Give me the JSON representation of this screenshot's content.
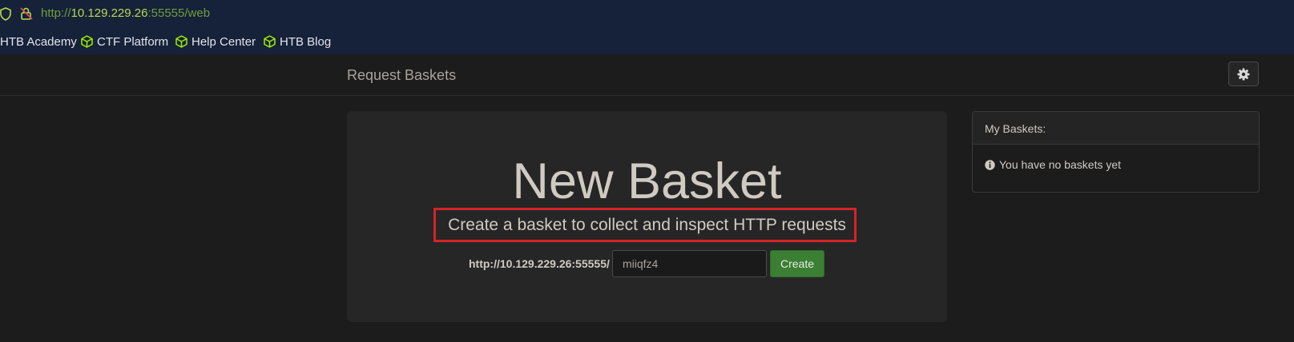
{
  "browser": {
    "url_scheme": "http://",
    "url_host": "10.129.229.26",
    "url_rest": ":55555/web",
    "bookmarks": [
      {
        "label": "HTB Academy",
        "icon": "none"
      },
      {
        "label": "CTF Platform",
        "icon": "cube-icon"
      },
      {
        "label": "Help Center",
        "icon": "cube-icon"
      },
      {
        "label": "HTB Blog",
        "icon": "cube-icon"
      }
    ],
    "accent_color": "#9fef00"
  },
  "navbar": {
    "brand": "Request Baskets",
    "settings_icon": "gear-icon"
  },
  "main": {
    "title": "New Basket",
    "subtitle": "Create a basket to collect and inspect HTTP requests",
    "url_prefix": "http://10.129.229.26:55555/",
    "basket_name": "miiqfz4",
    "create_label": "Create"
  },
  "side_panel": {
    "heading": "My Baskets:",
    "empty_message": "You have no baskets yet",
    "info_icon": "info-circle-icon"
  }
}
